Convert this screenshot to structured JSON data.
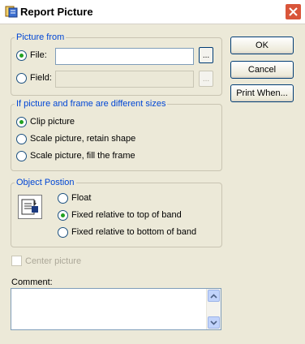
{
  "window": {
    "title": "Report Picture"
  },
  "picture_from": {
    "legend": "Picture from",
    "file_label": "File:",
    "file_value": "",
    "field_label": "Field:",
    "field_value": "",
    "browse_label": "..."
  },
  "sizes": {
    "legend": "If picture and frame are different sizes",
    "options": [
      "Clip picture",
      "Scale picture, retain shape",
      "Scale picture, fill the frame"
    ],
    "selected": "Clip picture"
  },
  "position": {
    "legend": "Object Postion",
    "options": [
      "Float",
      "Fixed relative to top of band",
      "Fixed relative to bottom of band"
    ],
    "selected": "Fixed relative to top of band"
  },
  "center_picture": {
    "label": "Center picture",
    "checked": false,
    "enabled": false
  },
  "comment": {
    "label": "Comment:",
    "value": ""
  },
  "buttons": {
    "ok": "OK",
    "cancel": "Cancel",
    "print_when": "Print When..."
  }
}
